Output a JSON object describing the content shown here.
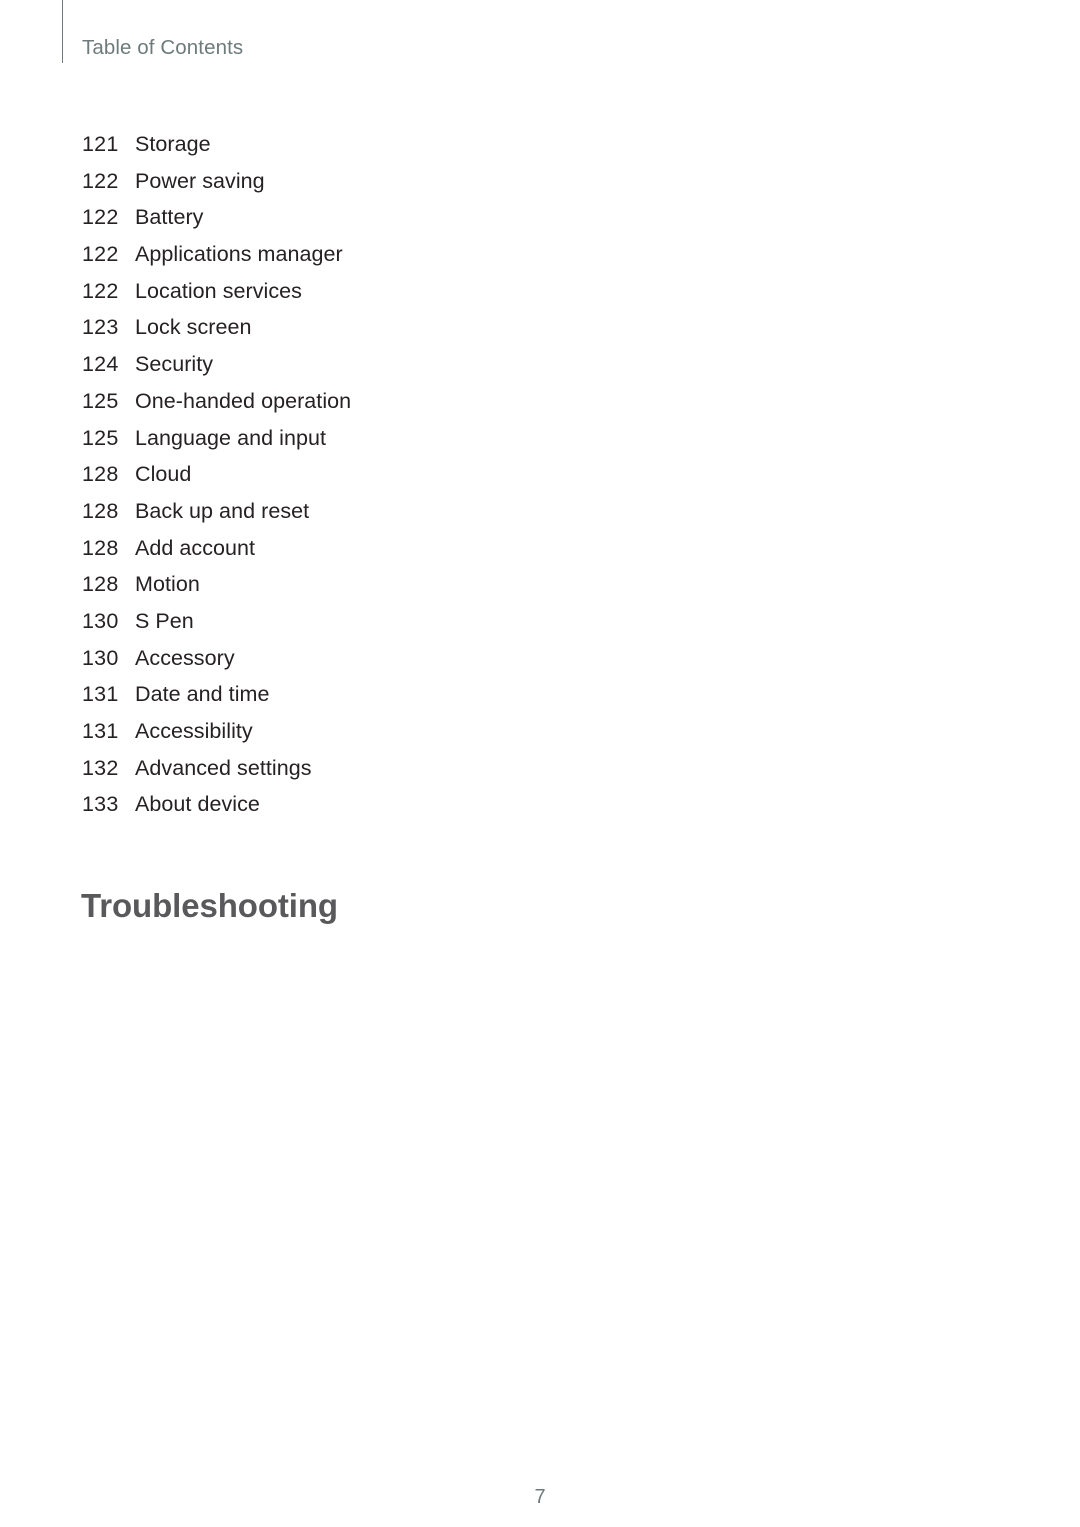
{
  "header": {
    "title": "Table of Contents"
  },
  "toc": {
    "entries": [
      {
        "page": "121",
        "label": "Storage"
      },
      {
        "page": "122",
        "label": "Power saving"
      },
      {
        "page": "122",
        "label": "Battery"
      },
      {
        "page": "122",
        "label": "Applications manager"
      },
      {
        "page": "122",
        "label": "Location services"
      },
      {
        "page": "123",
        "label": "Lock screen"
      },
      {
        "page": "124",
        "label": "Security"
      },
      {
        "page": "125",
        "label": "One-handed operation"
      },
      {
        "page": "125",
        "label": "Language and input"
      },
      {
        "page": "128",
        "label": "Cloud"
      },
      {
        "page": "128",
        "label": "Back up and reset"
      },
      {
        "page": "128",
        "label": "Add account"
      },
      {
        "page": "128",
        "label": "Motion"
      },
      {
        "page": "130",
        "label": "S Pen"
      },
      {
        "page": "130",
        "label": "Accessory"
      },
      {
        "page": "131",
        "label": "Date and time"
      },
      {
        "page": "131",
        "label": "Accessibility"
      },
      {
        "page": "132",
        "label": "Advanced settings"
      },
      {
        "page": "133",
        "label": "About device"
      }
    ]
  },
  "section": {
    "heading": "Troubleshooting"
  },
  "footer": {
    "page_number": "7"
  },
  "colors": {
    "header_text": "#6e7a7b",
    "body_text": "#262122",
    "heading_text": "#59595c",
    "folio_text": "#6e7a7b",
    "rule": "#6e7a7b",
    "background": "#ffffff"
  }
}
